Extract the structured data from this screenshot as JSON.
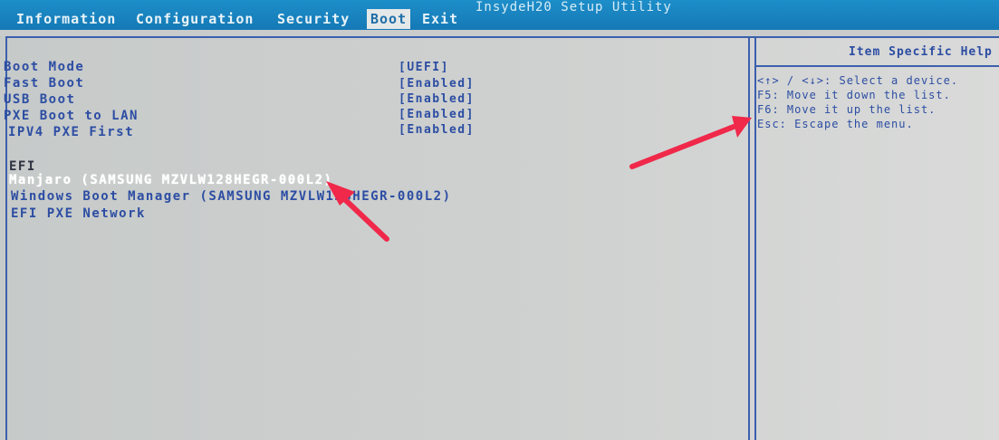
{
  "app": {
    "title": "InsydeH20 Setup Utility"
  },
  "menu": [
    {
      "label": "Information",
      "active": false
    },
    {
      "label": "Configuration",
      "active": false
    },
    {
      "label": "Security",
      "active": false
    },
    {
      "label": "Boot",
      "active": true
    },
    {
      "label": "Exit",
      "active": false
    }
  ],
  "settings": [
    {
      "label": "Boot Mode",
      "value": "[UEFI]"
    },
    {
      "label": "Fast Boot",
      "value": "[Enabled]"
    },
    {
      "label": "USB Boot",
      "value": "[Enabled]"
    },
    {
      "label": "PXE Boot to LAN",
      "value": "[Enabled]"
    },
    {
      "label": "IPV4 PXE First",
      "value": "[Enabled]"
    }
  ],
  "boot_list": {
    "section_label": "EFI",
    "items": [
      {
        "label": "Manjaro (SAMSUNG MZVLW128HEGR-000L2)",
        "selected": true
      },
      {
        "label": "Windows Boot Manager (SAMSUNG MZVLW128HEGR-000L2)",
        "selected": false
      },
      {
        "label": "EFI PXE Network",
        "selected": false
      }
    ]
  },
  "help": {
    "title": "Item Specific Help",
    "lines": [
      "<↑> / <↓>: Select a device.",
      "F5: Move it down the list.",
      "F6: Move it up the list.",
      "Esc: Escape the menu."
    ]
  },
  "colors": {
    "menu_bar": "#1a85c0",
    "panel_bg": "#c9cccb",
    "text_blue": "#2c4da3",
    "selected_text": "#ffffff",
    "annotation_arrow": "#f0284a"
  }
}
